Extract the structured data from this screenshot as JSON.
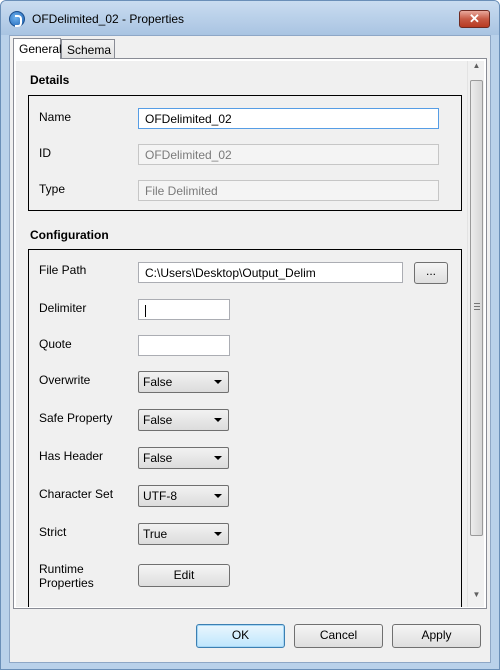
{
  "window": {
    "title": "OFDelimited_02 - Properties",
    "close_label": "✕"
  },
  "tabs": [
    {
      "label": "General",
      "active": true
    },
    {
      "label": "Schema",
      "active": false
    }
  ],
  "details": {
    "section_title": "Details",
    "name": {
      "label": "Name",
      "value": "OFDelimited_02"
    },
    "id": {
      "label": "ID",
      "value": "OFDelimited_02"
    },
    "type": {
      "label": "Type",
      "value": "File Delimited"
    }
  },
  "configuration": {
    "section_title": "Configuration",
    "file_path": {
      "label": "File Path",
      "value": "C:\\Users\\Desktop\\Output_Delim",
      "browse_label": "..."
    },
    "delimiter": {
      "label": "Delimiter",
      "value": ""
    },
    "quote": {
      "label": "Quote",
      "value": ""
    },
    "overwrite": {
      "label": "Overwrite",
      "value": "False"
    },
    "safe_property": {
      "label": "Safe Property",
      "value": "False"
    },
    "has_header": {
      "label": "Has Header",
      "value": "False"
    },
    "character_set": {
      "label": "Character Set",
      "value": "UTF-8"
    },
    "strict": {
      "label": "Strict",
      "value": "True"
    },
    "runtime_properties": {
      "label_line1": "Runtime",
      "label_line2": "Properties",
      "button_label": "Edit"
    }
  },
  "footer": {
    "ok_label": "OK",
    "cancel_label": "Cancel",
    "apply_label": "Apply"
  }
}
